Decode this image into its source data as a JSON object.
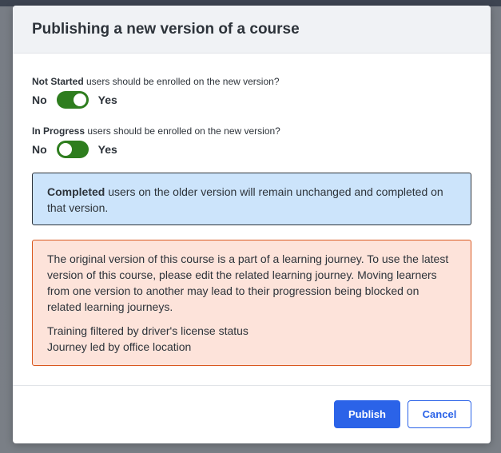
{
  "dialog": {
    "title": "Publishing a new version of a course"
  },
  "questions": [
    {
      "status_label": "Not Started",
      "text": " users should be enrolled on the new version?",
      "no_label": "No",
      "yes_label": "Yes",
      "toggle_on": true
    },
    {
      "status_label": "In Progress",
      "text": " users should be enrolled on the new version?",
      "no_label": "No",
      "yes_label": "Yes",
      "toggle_on": false
    }
  ],
  "info": {
    "bold": "Completed",
    "text": " users on the older version will remain unchanged and completed on that version."
  },
  "warning": {
    "text": "The original version of this course is a part of a learning journey. To use the latest version of this course, please edit the related learning journey. Moving learners from one version to another may lead to their progression being blocked on related learning journeys.",
    "items": [
      "Training filtered by driver's license status",
      "Journey led by office location"
    ]
  },
  "footer": {
    "publish_label": "Publish",
    "cancel_label": "Cancel"
  },
  "colors": {
    "primary": "#2b63e8",
    "toggle_on": "#2e7d1e",
    "info_bg": "#cce4fb",
    "warning_bg": "#fde3da",
    "warning_border": "#d9581f"
  }
}
